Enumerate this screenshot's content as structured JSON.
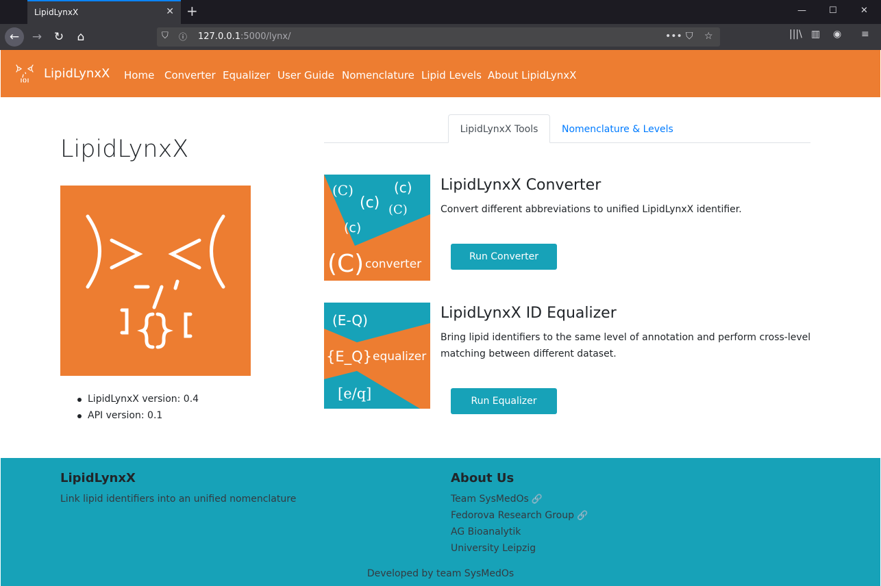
{
  "browser": {
    "tab_title": "LipidLynxX",
    "url_host": "127.0.0.1",
    "url_path": ":5000/lynx/"
  },
  "site": {
    "brand": "LipidLynxX",
    "nav": [
      "Home",
      "Converter",
      "Equalizer",
      "User Guide",
      "Nomenclature",
      "Lipid Levels",
      "About LipidLynxX"
    ],
    "accent_color": "#ed7d31",
    "teal_color": "#17a2b8"
  },
  "main": {
    "title": "LipidLynxX",
    "versions": [
      "LipidLynxX version: 0.4",
      "API version: 0.1"
    ],
    "tabs": [
      "LipidLynxX Tools",
      "Nomenclature & Levels"
    ],
    "tools": [
      {
        "title": "LipidLynxX Converter",
        "description": "Convert different abbreviations to unified LipidLynxX identifier.",
        "button": "Run Converter",
        "image_text": [
          "(C)",
          "(c)",
          "(c)",
          "(C)",
          "(c)",
          "(C)",
          "converter"
        ]
      },
      {
        "title": "LipidLynxX ID Equalizer",
        "description": "Bring lipid identifiers to the same level of annotation and perform cross-level matching between different dataset.",
        "button": "Run Equalizer",
        "image_text": [
          "(E-Q)",
          "{E_Q}",
          "equalizer",
          "[e/q]"
        ]
      }
    ]
  },
  "footer": {
    "left_title": "LipidLynxX",
    "left_text": "Link lipid identifiers into an unified nomenclature",
    "right_title": "About Us",
    "links": [
      "Team SysMedOs",
      "Fedorova Research Group",
      "AG Bioanalytik",
      "University Leipzig"
    ],
    "bottom": "Developed by team SysMedOs"
  }
}
